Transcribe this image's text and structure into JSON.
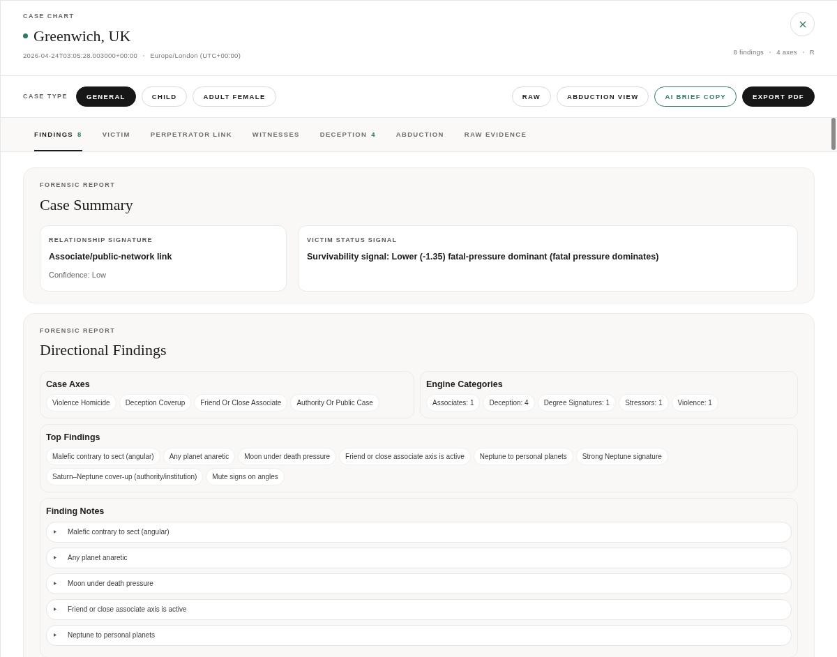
{
  "header": {
    "eyebrow": "CASE CHART",
    "title": "Greenwich, UK",
    "timestamp": "2026-04-24T03:05:28.003000+00:00",
    "timezone": "Europe/London (UTC+00:00)",
    "stats": [
      "8 findings",
      "4 axes",
      "R"
    ]
  },
  "case_type": {
    "label": "CASE TYPE",
    "options": [
      {
        "label": "GENERAL",
        "selected": true
      },
      {
        "label": "CHILD",
        "selected": false
      },
      {
        "label": "ADULT FEMALE",
        "selected": false
      }
    ]
  },
  "actions": [
    {
      "label": "RAW",
      "kind": "outline"
    },
    {
      "label": "ABDUCTION VIEW",
      "kind": "outline"
    },
    {
      "label": "AI BRIEF COPY",
      "kind": "accent"
    },
    {
      "label": "EXPORT PDF",
      "kind": "dark"
    }
  ],
  "tabs": [
    {
      "label": "FINDINGS",
      "count": "8",
      "selected": true
    },
    {
      "label": "VICTIM",
      "selected": false
    },
    {
      "label": "PERPETRATOR LINK",
      "selected": false
    },
    {
      "label": "WITNESSES",
      "selected": false
    },
    {
      "label": "DECEPTION",
      "count": "4",
      "selected": false
    },
    {
      "label": "ABDUCTION",
      "selected": false
    },
    {
      "label": "RAW EVIDENCE",
      "selected": false
    }
  ],
  "summary": {
    "eyebrow": "FORENSIC REPORT",
    "title": "Case Summary",
    "cards": [
      {
        "label": "RELATIONSHIP SIGNATURE",
        "value": "Associate/public-network link",
        "note": "Confidence: Low"
      },
      {
        "label": "VICTIM STATUS SIGNAL",
        "value": "Survivability signal: Lower (-1.35) fatal-pressure dominant (fatal pressure dominates)"
      }
    ]
  },
  "directional": {
    "eyebrow": "FORENSIC REPORT",
    "title": "Directional Findings",
    "case_axes": {
      "title": "Case Axes",
      "chips": [
        "Violence Homicide",
        "Deception Coverup",
        "Friend Or Close Associate",
        "Authority Or Public Case"
      ]
    },
    "engine_categories": {
      "title": "Engine Categories",
      "chips": [
        "Associates: 1",
        "Deception: 4",
        "Degree Signatures: 1",
        "Stressors: 1",
        "Violence: 1"
      ]
    },
    "top_findings": {
      "title": "Top Findings",
      "chips": [
        "Malefic contrary to sect (angular)",
        "Any planet anaretic",
        "Moon under death pressure",
        "Friend or close associate axis is active",
        "Neptune to personal planets",
        "Strong Neptune signature",
        "Saturn–Neptune cover-up (authority/institution)",
        "Mute signs on angles"
      ]
    },
    "finding_notes": {
      "title": "Finding Notes",
      "items": [
        {
          "label": "Malefic contrary to sect (angular)",
          "expanded": false
        },
        {
          "label": "Any planet anaretic",
          "expanded": false
        },
        {
          "label": "Moon under death pressure",
          "expanded": false
        },
        {
          "label": "Friend or close associate axis is active",
          "expanded": false
        },
        {
          "label": "Neptune to personal planets",
          "expanded": false
        }
      ]
    }
  }
}
